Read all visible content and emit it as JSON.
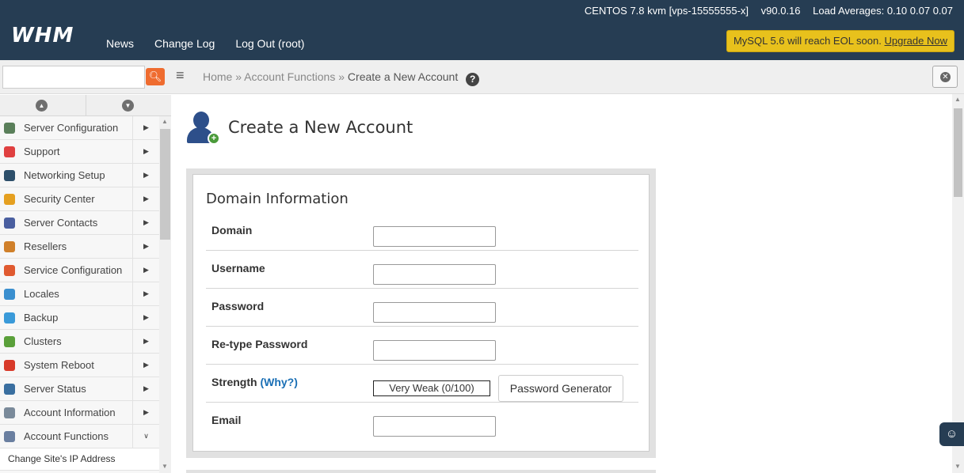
{
  "header": {
    "logo": "WHM",
    "os": "CENTOS 7.8 kvm [vps-15555555-x]",
    "version": "v90.0.16",
    "load_averages": "Load Averages: 0.10 0.07 0.07",
    "nav": [
      "News",
      "Change Log",
      "Log Out (root)"
    ],
    "eol_notice": "MySQL 5.6 will reach EOL soon.",
    "eol_link": "Upgrade Now"
  },
  "search": {
    "value": "",
    "placeholder": ""
  },
  "breadcrumb": {
    "home": "Home",
    "sep": "»",
    "section": "Account Functions",
    "current": "Create a New Account",
    "help": "?"
  },
  "sidebar": {
    "items": [
      {
        "label": "Server Configuration",
        "icon": "server-config-icon",
        "color": "#5a7f5a"
      },
      {
        "label": "Support",
        "icon": "lifebuoy-icon",
        "color": "#e04040"
      },
      {
        "label": "Networking Setup",
        "icon": "network-icon",
        "color": "#2d4f6a"
      },
      {
        "label": "Security Center",
        "icon": "lock-icon",
        "color": "#e5a020"
      },
      {
        "label": "Server Contacts",
        "icon": "contacts-icon",
        "color": "#4a5fa0"
      },
      {
        "label": "Resellers",
        "icon": "resellers-icon",
        "color": "#d0802a"
      },
      {
        "label": "Service Configuration",
        "icon": "service-config-icon",
        "color": "#e05a30"
      },
      {
        "label": "Locales",
        "icon": "locales-icon",
        "color": "#3a8fcf"
      },
      {
        "label": "Backup",
        "icon": "backup-icon",
        "color": "#3a9ad9"
      },
      {
        "label": "Clusters",
        "icon": "clusters-icon",
        "color": "#5aa03a"
      },
      {
        "label": "System Reboot",
        "icon": "power-icon",
        "color": "#d83a2a"
      },
      {
        "label": "Server Status",
        "icon": "monitor-icon",
        "color": "#3a6fa0"
      },
      {
        "label": "Account Information",
        "icon": "account-info-icon",
        "color": "#7a8a9a"
      },
      {
        "label": "Account Functions",
        "icon": "account-functions-icon",
        "color": "#6a7fa0"
      }
    ],
    "expanded_arrow": "▶",
    "open_arrow": "∨",
    "sub_item": "Change Site's IP Address"
  },
  "page": {
    "title": "Create a New Account",
    "section_title": "Domain Information",
    "fields": [
      {
        "label": "Domain",
        "value": ""
      },
      {
        "label": "Username",
        "value": ""
      },
      {
        "label": "Password",
        "value": ""
      },
      {
        "label": "Re-type Password",
        "value": ""
      }
    ],
    "strength_label": "Strength",
    "why_label": "(Why?)",
    "strength_value": "Very Weak (0/100)",
    "password_generator": "Password Generator",
    "email_label": "Email",
    "email_value": ""
  },
  "colors": {
    "header_bg": "#263d53",
    "eol_bg": "#e8c11c",
    "search_btn": "#ef6c2f",
    "link": "#1a6fb5"
  }
}
